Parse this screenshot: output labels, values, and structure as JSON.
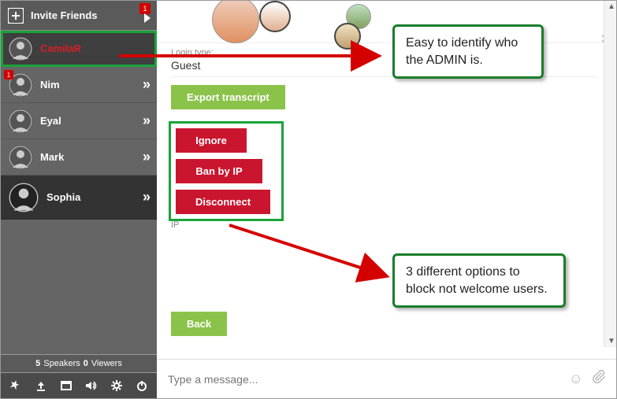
{
  "sidebar": {
    "invite_label": "Invite Friends",
    "invite_badge": "1",
    "users": [
      {
        "name": "CamilaR",
        "badge": null
      },
      {
        "name": "Nim",
        "badge": "1"
      },
      {
        "name": "Eyal",
        "badge": null
      },
      {
        "name": "Mark",
        "badge": null
      },
      {
        "name": "Sophia",
        "badge": null
      }
    ],
    "stats": {
      "speakers_count": "5",
      "speakers_label": "Speakers",
      "viewers_count": "0",
      "viewers_label": "Viewers"
    }
  },
  "panel": {
    "login_type_label": "Login type:",
    "login_type_value": "Guest",
    "export_label": "Export transcript",
    "ignore_label": "Ignore",
    "ban_label": "Ban by IP",
    "disconnect_label": "Disconnect",
    "ip_label": "IP",
    "back_label": "Back"
  },
  "composer": {
    "placeholder": "Type a message..."
  },
  "callouts": {
    "c1": "Easy to identify who the ADMIN is.",
    "c2": "3 different options to block not welcome users."
  }
}
